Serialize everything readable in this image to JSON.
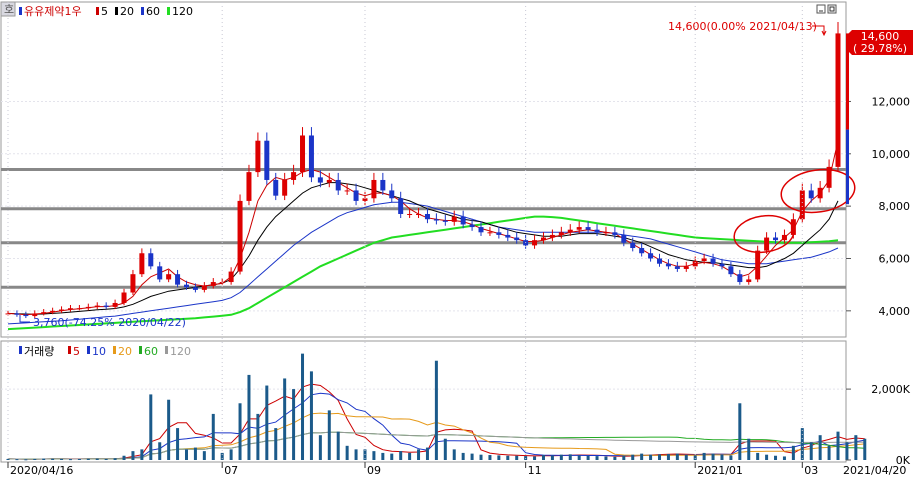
{
  "chart_data": [
    {
      "type": "candlestick",
      "title": "유유제약1우",
      "legend": [
        {
          "label": "5",
          "color": "#cc0000"
        },
        {
          "label": "20",
          "color": "#000000"
        },
        {
          "label": "60",
          "color": "#1b35c8"
        },
        {
          "label": "120",
          "color": "#22dd22"
        }
      ],
      "ylim": [
        3000,
        15800
      ],
      "y_ticks": [
        4000,
        6000,
        8000,
        10000,
        12000
      ],
      "y_tick_labels": [
        "4,000",
        "6,000",
        "8,000",
        "10,000",
        "12,000"
      ],
      "horizontal_lines": [
        9400,
        7900,
        6600,
        4900
      ],
      "last_price_label": "14,600",
      "last_change_label": "( 29.78%)",
      "high_annotation": "14,600(0.00% 2021/04/13)",
      "low_annotation": "3,760(-74.25% 2020/04/22)",
      "close_series": [
        3900,
        3850,
        3800,
        3900,
        3950,
        4000,
        4050,
        4100,
        4100,
        4150,
        4200,
        4150,
        4300,
        4700,
        5400,
        6200,
        5700,
        5200,
        5400,
        5000,
        4900,
        4800,
        4950,
        5100,
        5100,
        5500,
        8200,
        9300,
        10500,
        9000,
        8400,
        9000,
        9300,
        10700,
        9100,
        8900,
        9000,
        8600,
        8600,
        8200,
        8300,
        9000,
        8600,
        8300,
        7700,
        7700,
        7700,
        7500,
        7450,
        7400,
        7600,
        7300,
        7200,
        7000,
        7000,
        6900,
        6800,
        6700,
        6500,
        6700,
        6800,
        6900,
        7000,
        7100,
        7200,
        7100,
        7000,
        7000,
        6900,
        6600,
        6400,
        6200,
        6000,
        5800,
        5700,
        5600,
        5700,
        5900,
        6000,
        5800,
        5700,
        5400,
        5100,
        5200,
        6300,
        6800,
        6700,
        6900,
        7500,
        8600,
        8300,
        8700,
        9500,
        14600
      ],
      "ma5": [
        3900,
        3880,
        3850,
        3880,
        3900,
        3950,
        4000,
        4050,
        4080,
        4120,
        4160,
        4160,
        4200,
        4300,
        4550,
        5000,
        5300,
        5450,
        5600,
        5300,
        5100,
        5000,
        4950,
        5000,
        5050,
        5300,
        6000,
        7000,
        8200,
        8800,
        9100,
        9000,
        9100,
        9300,
        9400,
        9300,
        9100,
        8900,
        8700,
        8500,
        8400,
        8500,
        8500,
        8400,
        8200,
        7900,
        7700,
        7550,
        7500,
        7450,
        7450,
        7400,
        7300,
        7150,
        7050,
        6950,
        6850,
        6750,
        6650,
        6650,
        6700,
        6800,
        6900,
        7000,
        7050,
        7100,
        7050,
        7000,
        6950,
        6750,
        6550,
        6350,
        6150,
        5950,
        5800,
        5700,
        5700,
        5800,
        5850,
        5800,
        5700,
        5500,
        5300,
        5400,
        5700,
        6100,
        6500,
        6800,
        7100,
        7800,
        8200,
        8500,
        9000,
        10500
      ],
      "ma20": [
        3900,
        3890,
        3880,
        3870,
        3880,
        3900,
        3920,
        3950,
        3980,
        4010,
        4040,
        4060,
        4090,
        4150,
        4250,
        4400,
        4550,
        4650,
        4750,
        4800,
        4850,
        4900,
        4950,
        5000,
        5050,
        5200,
        5600,
        6100,
        6700,
        7200,
        7600,
        7900,
        8200,
        8500,
        8700,
        8800,
        8900,
        8900,
        8850,
        8800,
        8700,
        8600,
        8500,
        8400,
        8300,
        8200,
        8050,
        7900,
        7800,
        7700,
        7600,
        7500,
        7450,
        7400,
        7300,
        7200,
        7100,
        7000,
        6950,
        6900,
        6850,
        6850,
        6850,
        6900,
        6950,
        6950,
        6950,
        6900,
        6850,
        6800,
        6700,
        6600,
        6450,
        6300,
        6150,
        6050,
        5950,
        5900,
        5850,
        5850,
        5800,
        5750,
        5700,
        5650,
        5650,
        5700,
        5850,
        6000,
        6200,
        6500,
        6800,
        7100,
        7500,
        8200
      ],
      "ma60": [
        3500,
        3520,
        3540,
        3560,
        3580,
        3600,
        3620,
        3650,
        3680,
        3710,
        3740,
        3770,
        3800,
        3850,
        3900,
        3950,
        4000,
        4050,
        4100,
        4150,
        4200,
        4250,
        4300,
        4350,
        4400,
        4500,
        4700,
        5000,
        5300,
        5600,
        5900,
        6200,
        6500,
        6750,
        7000,
        7200,
        7400,
        7600,
        7750,
        7850,
        7950,
        8050,
        8100,
        8150,
        8150,
        8100,
        8050,
        8000,
        7900,
        7800,
        7700,
        7600,
        7500,
        7400,
        7300,
        7200,
        7150,
        7100,
        7050,
        7000,
        7000,
        7000,
        7000,
        7000,
        7000,
        7000,
        7000,
        7000,
        6950,
        6900,
        6850,
        6800,
        6750,
        6650,
        6550,
        6450,
        6350,
        6250,
        6150,
        6050,
        5950,
        5900,
        5850,
        5800,
        5800,
        5800,
        5850,
        5900,
        5950,
        6000,
        6050,
        6150,
        6250,
        6400
      ],
      "ma120": [
        3300,
        3320,
        3340,
        3360,
        3380,
        3400,
        3420,
        3440,
        3460,
        3480,
        3500,
        3520,
        3540,
        3560,
        3580,
        3600,
        3620,
        3640,
        3660,
        3680,
        3700,
        3720,
        3750,
        3780,
        3810,
        3850,
        3950,
        4100,
        4300,
        4500,
        4700,
        4900,
        5100,
        5300,
        5500,
        5700,
        5850,
        6000,
        6150,
        6300,
        6450,
        6600,
        6700,
        6800,
        6850,
        6900,
        6950,
        7000,
        7050,
        7100,
        7150,
        7200,
        7250,
        7300,
        7350,
        7400,
        7450,
        7500,
        7550,
        7600,
        7600,
        7580,
        7550,
        7500,
        7450,
        7400,
        7350,
        7300,
        7250,
        7200,
        7150,
        7100,
        7050,
        7000,
        6950,
        6900,
        6850,
        6800,
        6780,
        6760,
        6740,
        6720,
        6700,
        6680,
        6660,
        6640,
        6620,
        6600,
        6600,
        6600,
        6620,
        6640,
        6660,
        6700
      ]
    },
    {
      "type": "bar",
      "title": "거래량",
      "legend": [
        {
          "label": "5",
          "color": "#cc0000"
        },
        {
          "label": "10",
          "color": "#1b35c8"
        },
        {
          "label": "20",
          "color": "#e69a1a"
        },
        {
          "label": "60",
          "color": "#22aa22"
        },
        {
          "label": "120",
          "color": "#999999"
        }
      ],
      "ylim": [
        0,
        3300
      ],
      "y_ticks": [
        0,
        2000
      ],
      "y_tick_labels": [
        "0K",
        "2,000K"
      ],
      "values": [
        30,
        25,
        20,
        30,
        40,
        35,
        30,
        25,
        30,
        35,
        40,
        30,
        50,
        120,
        250,
        300,
        1850,
        500,
        1700,
        900,
        300,
        350,
        250,
        1300,
        200,
        300,
        1600,
        2400,
        1300,
        2100,
        900,
        2300,
        2000,
        3000,
        2500,
        700,
        1400,
        800,
        400,
        300,
        300,
        250,
        200,
        180,
        250,
        200,
        300,
        350,
        2800,
        600,
        300,
        200,
        180,
        150,
        140,
        130,
        120,
        120,
        110,
        100,
        140,
        130,
        150,
        160,
        130,
        120,
        110,
        100,
        90,
        120,
        150,
        180,
        150,
        160,
        170,
        180,
        140,
        130,
        200,
        180,
        150,
        130,
        1600,
        600,
        200,
        150,
        120,
        100,
        400,
        900,
        500,
        700,
        400,
        800,
        500,
        700,
        600
      ]
    }
  ],
  "x_axis": {
    "date_labels": [
      "2020/04/16",
      "07",
      "09",
      "11",
      "2021/01",
      "03"
    ],
    "end_label": "2021/04/20"
  },
  "colors": {
    "up": "#dd0000",
    "down": "#1b35c8",
    "ma120": "#22dd22",
    "hline": "#888888",
    "highlight": "#dd0000"
  }
}
